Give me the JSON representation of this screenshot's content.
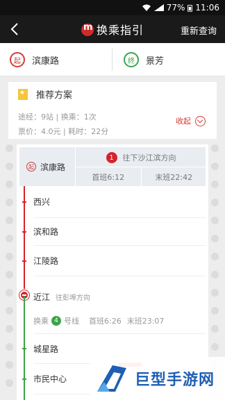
{
  "status_bar": {
    "battery": "77%",
    "time": "11:06"
  },
  "header": {
    "title": "换乘指引",
    "requery_label": "重新查询"
  },
  "route": {
    "from_marker": "起",
    "from": "滨康路",
    "to_marker": "终",
    "to": "景芳"
  },
  "recommendation": {
    "title": "推荐方案",
    "stats_line1": "途经：9站 | 换乘：1次",
    "stats_line2": "票价：4.0元 | 耗时：22分",
    "collapse_label": "收起"
  },
  "segment1": {
    "start_marker": "起",
    "station": "滨康路",
    "line_no": "1",
    "direction": "往下沙江滨方向",
    "first_train": "首班6:12",
    "last_train": "末班22:42",
    "stops": [
      "西兴",
      "滨和路",
      "江陵路"
    ]
  },
  "transfer": {
    "station": "近江",
    "direction": "往彭埠方向",
    "label_prefix": "换乘",
    "line_no": "4",
    "label_suffix": "号线",
    "first_train": "首班6:26",
    "last_train": "末班23:07"
  },
  "segment2": {
    "stops": [
      "城星路",
      "市民中心"
    ]
  },
  "watermark": {
    "text": "巨型手游网"
  },
  "colors": {
    "line1": "#d6232b",
    "line4": "#3aa446",
    "accent": "#d53a35"
  }
}
